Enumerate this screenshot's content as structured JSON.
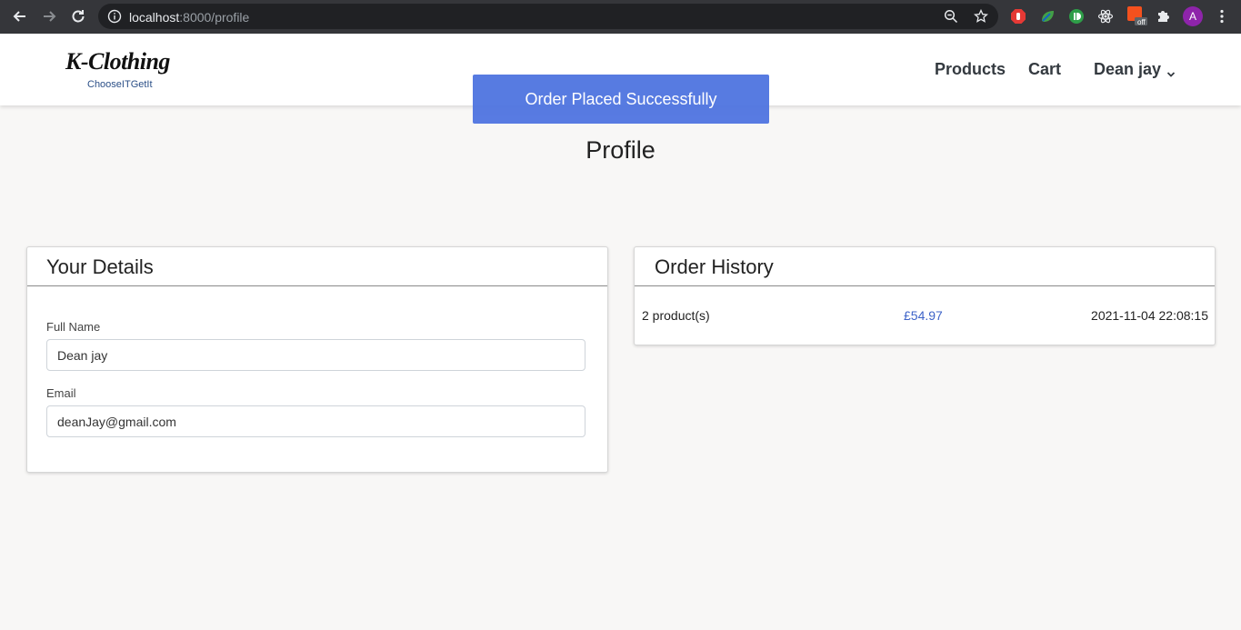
{
  "browser": {
    "url_host": "localhost",
    "url_path": ":8000/profile",
    "avatar_initial": "A",
    "ext_badge": "off"
  },
  "site": {
    "logo_title": "K-Clothing",
    "logo_tagline": "ChooseITGetIt",
    "nav": {
      "products": "Products",
      "cart": "Cart",
      "user": "Dean jay"
    }
  },
  "toast": {
    "message": "Order Placed Successfully"
  },
  "page": {
    "title": "Profile"
  },
  "details": {
    "heading": "Your Details",
    "full_name_label": "Full Name",
    "full_name_value": "Dean jay",
    "email_label": "Email",
    "email_value": "deanJay@gmail.com"
  },
  "order_history": {
    "heading": "Order History",
    "orders": [
      {
        "products": "2 product(s)",
        "price": "£54.97",
        "date": "2021-11-04 22:08:15"
      }
    ]
  },
  "colors": {
    "accent": "#4f74e0",
    "price": "#3d63c8",
    "chrome": "#35363a"
  }
}
